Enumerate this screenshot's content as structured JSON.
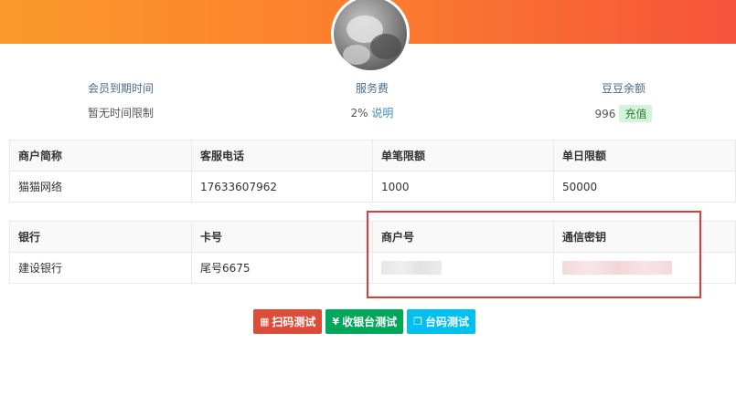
{
  "header": {
    "brand_gradient": [
      "#fb9a2a",
      "#f5533a"
    ]
  },
  "stats": [
    {
      "label": "会员到期时间",
      "value": "暂无时间限制"
    },
    {
      "label": "服务费",
      "value": "2%",
      "link": "说明"
    },
    {
      "label": "豆豆余额",
      "value": "996",
      "badge": "充值"
    }
  ],
  "merchant_table": {
    "headers": [
      "商户简称",
      "客服电话",
      "单笔限额",
      "单日限额"
    ],
    "row": [
      "猫猫网络",
      "17633607962",
      "1000",
      "50000"
    ]
  },
  "bank_table": {
    "headers": [
      "银行",
      "卡号",
      "商户号",
      "通信密钥"
    ],
    "row": [
      "建设银行",
      "尾号6675"
    ]
  },
  "actions": {
    "scan_test": "扫码测试",
    "cashier_test": "收银台测试",
    "qr_test": "台码测试"
  },
  "icons": {
    "scan": "qrcode-icon",
    "cashier": "yen-icon",
    "qr": "copy-icon"
  },
  "colors": {
    "highlight": "#e03b3b",
    "btn_red": "#dd4b39",
    "btn_green": "#00a65a",
    "btn_cyan": "#00c0ef"
  }
}
